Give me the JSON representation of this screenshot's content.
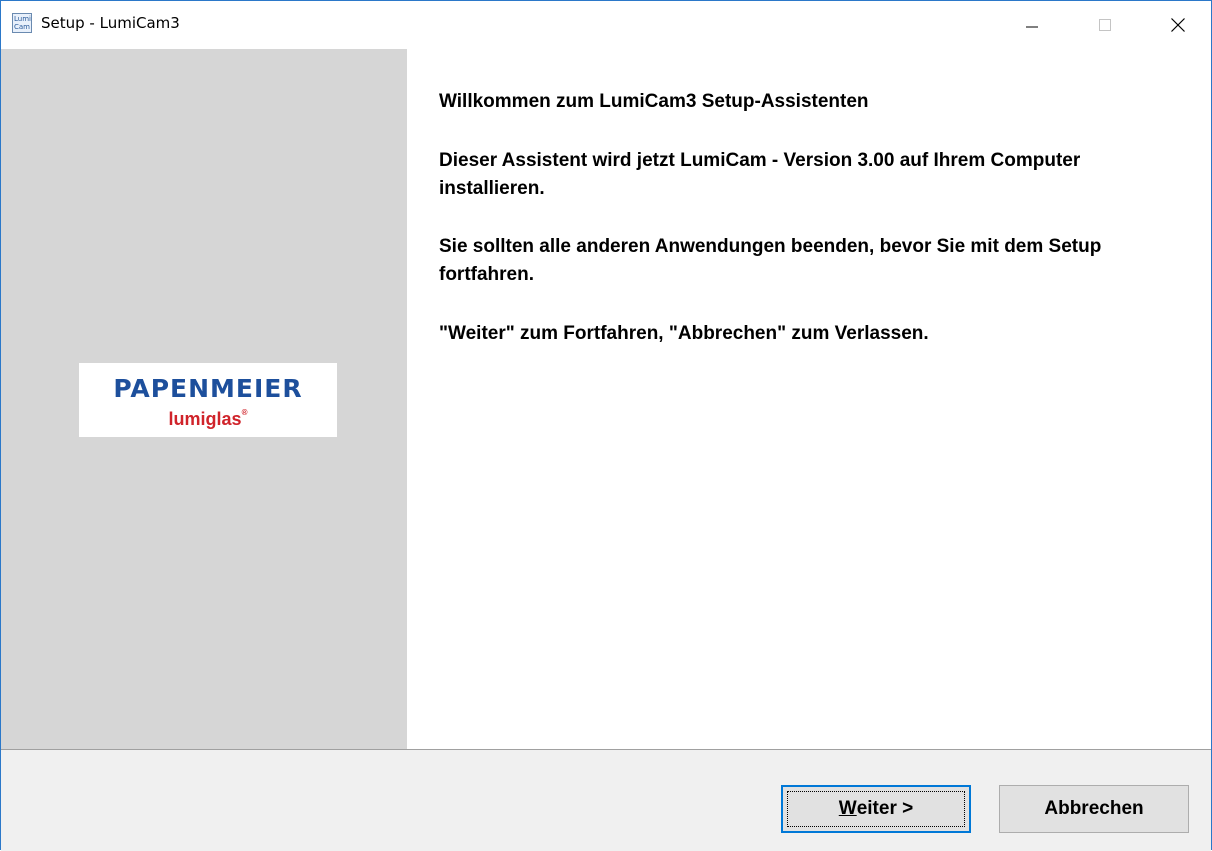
{
  "window": {
    "title": "Setup - LumiCam3",
    "icon_label_line1": "Lumi",
    "icon_label_line2": "Cam",
    "controls": {
      "minimize_icon": "minimize-icon",
      "maximize_icon": "maximize-icon",
      "close_icon": "close-icon"
    }
  },
  "sidebar": {
    "logo": {
      "brand": "PAPENMEIER",
      "sub_brand": "lumiglas",
      "registered_mark": "®",
      "brand_color": "#1d4f9c",
      "sub_brand_color": "#d0232a"
    }
  },
  "content": {
    "title": "Willkommen zum LumiCam3 Setup-Assistenten",
    "paragraphs": [
      "Dieser Assistent wird jetzt LumiCam - Version 3.00 auf Ihrem Computer installieren.",
      "Sie sollten alle anderen Anwendungen beenden, bevor Sie mit dem Setup fortfahren.",
      "\"Weiter\" zum Fortfahren, \"Abbrechen\" zum Verlassen."
    ]
  },
  "footer": {
    "next_button": {
      "mnemonic": "W",
      "rest": "eiter >"
    },
    "cancel_button": {
      "label": "Abbrechen"
    }
  }
}
